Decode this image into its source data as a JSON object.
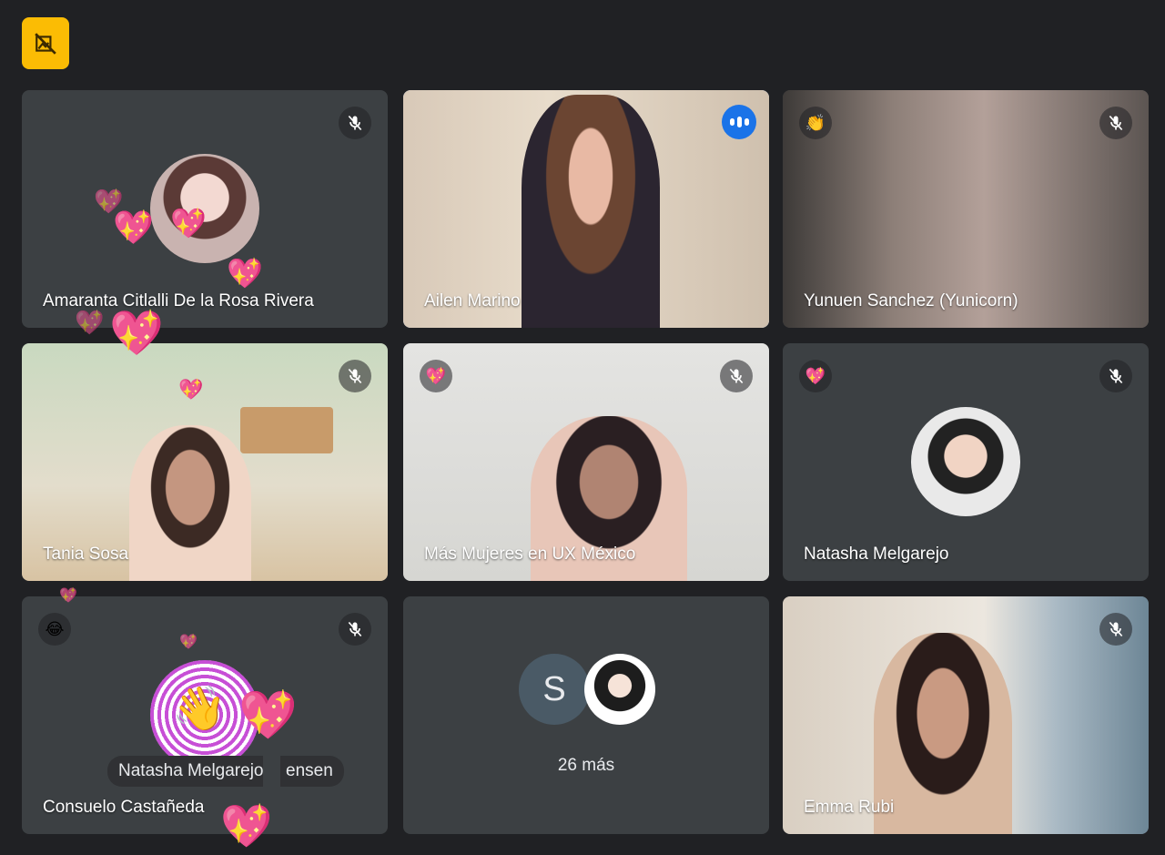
{
  "top_badge": {
    "icon": "no-camera-icon"
  },
  "tiles": [
    {
      "name": "Amaranta Citlalli De la Rosa Rivera",
      "mic": "muted"
    },
    {
      "name": "Ailen Marino",
      "mic": "speaking"
    },
    {
      "name": "Yunuen Sanchez (Yunicorn)",
      "mic": "muted",
      "reaction": "👏"
    },
    {
      "name": "Tania Sosa",
      "mic": "muted"
    },
    {
      "name": "Más Mujeres en UX México",
      "mic": "muted",
      "reaction": "💖"
    },
    {
      "name": "Natasha Melgarejo",
      "mic": "muted",
      "reaction": "💖"
    },
    {
      "name": "Consuelo Castañeda",
      "mic": "muted",
      "reaction": "😂"
    },
    {
      "more_letter": "S",
      "more_label": "26 más"
    },
    {
      "name": "Emma Rubi",
      "mic": "muted"
    }
  ],
  "tooltip": {
    "text": "Natasha Melgarejo",
    "partial": "ensen"
  },
  "hearts": "💖",
  "hand_emoji": "👋",
  "colors": {
    "background": "#202124",
    "tile": "#3c4043",
    "active_border": "#8ab4f8",
    "speaking": "#1a73e8",
    "badge": "#fbbc04"
  }
}
